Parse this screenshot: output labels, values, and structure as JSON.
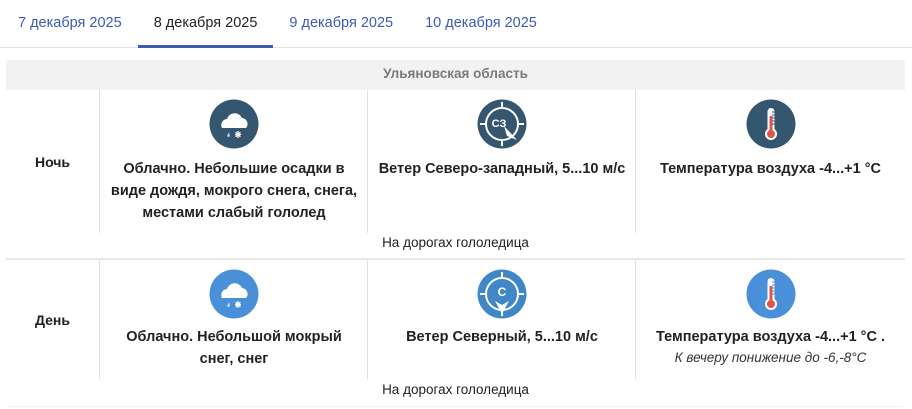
{
  "tabs": [
    {
      "label": "7 декабря 2025"
    },
    {
      "label": "8 декабря 2025"
    },
    {
      "label": "9 декабря 2025"
    },
    {
      "label": "10 декабря 2025"
    }
  ],
  "active_tab_index": 1,
  "colors": {
    "link": "#3b5bb5",
    "night_icon": "#34566e",
    "day_icon": "#4a90d9",
    "wind_icon": "#3f87c6"
  },
  "region": "Ульяновская область",
  "night": {
    "period": "Ночь",
    "weather": "Облачно. Небольшие осадки в виде дождя, мокрого снега, снега, местами слабый гололед",
    "weather_icon": "cloud-rain-snow-icon",
    "wind": "Ветер Северо-западный, 5...10 м/с",
    "wind_dir": "СЗ",
    "wind_icon": "wind-direction-northwest-icon",
    "temperature": "Температура воздуха -4...+1 °C",
    "temp_icon": "thermometer-icon",
    "roads": "На дорогах гололедица"
  },
  "day": {
    "period": "День",
    "weather": "Облачно. Небольшой мокрый снег, снег",
    "weather_icon": "cloud-rain-snow-icon",
    "wind": "Ветер Северный, 5...10 м/с",
    "wind_dir": "С",
    "wind_icon": "wind-direction-north-icon",
    "temperature": "Температура воздуха -4...+1 °C .",
    "temperature_note": "К вечеру понижение до -6,-8°C",
    "temp_icon": "thermometer-icon",
    "roads": "На дорогах гололедица"
  }
}
